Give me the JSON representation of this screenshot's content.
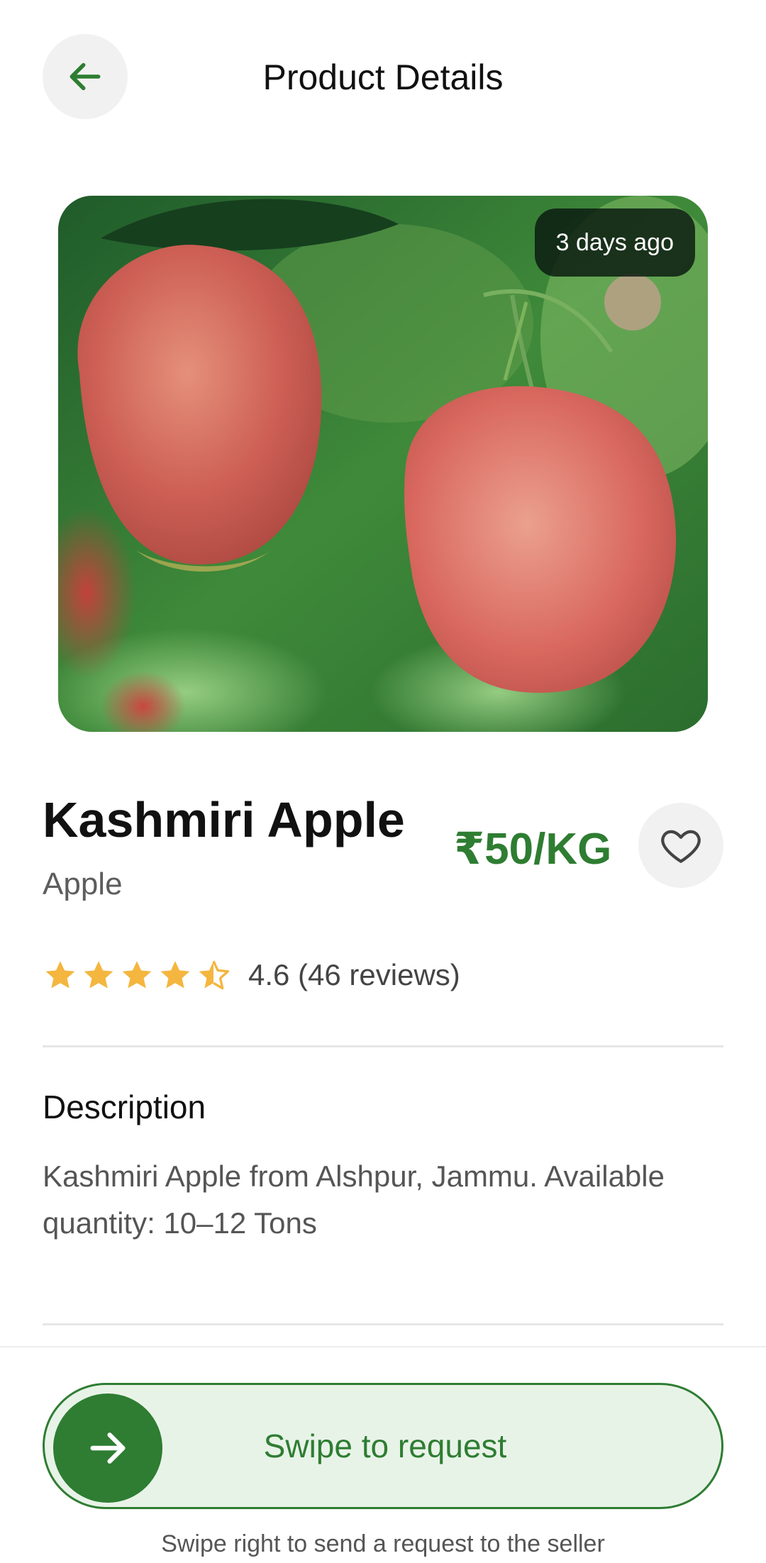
{
  "header": {
    "title": "Product Details",
    "back_icon": "arrow-left-icon"
  },
  "product": {
    "image_alt": "Kashmiri Apple photo",
    "posted_ago": "3 days ago",
    "name": "Kashmiri Apple",
    "category": "Apple",
    "price": "₹50/KG",
    "favorite_icon": "heart-outline-icon",
    "rating_value": 4.6,
    "rating_text": "4.6 (46 reviews)"
  },
  "description": {
    "title": "Description",
    "text": "Kashmiri Apple from Alshpur, Jammu. Available quantity: 10–12 Tons"
  },
  "swipe": {
    "label": "Swipe to request",
    "knob_icon": "arrow-right-icon",
    "hint": "Swipe right to send a request to the seller"
  },
  "colors": {
    "accent": "#2e7d32",
    "star": "#f4b63f",
    "swipe_bg": "#e8f3e8"
  }
}
